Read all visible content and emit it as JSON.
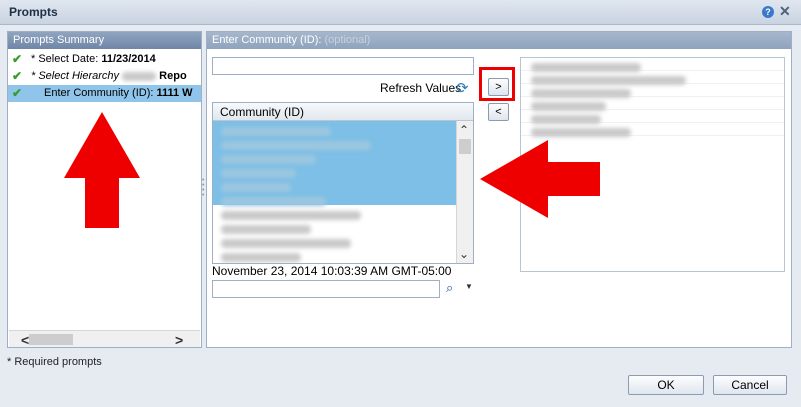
{
  "dialog": {
    "title": "Prompts",
    "help_icon": "help-icon",
    "close_icon": "close-icon"
  },
  "summary": {
    "header": "Prompts Summary",
    "items": [
      {
        "icon": "check-icon",
        "label": "* Select Date: ",
        "value": "11/23/2014"
      },
      {
        "icon": "check-icon",
        "label": "* Select Hierarchy",
        "value": "Repo"
      },
      {
        "icon": "check-icon",
        "label": "Enter Community (ID): ",
        "value": "1111 W"
      }
    ]
  },
  "prompt": {
    "header": "Enter Community (ID):",
    "optional_hint": "(optional)",
    "search_value": "",
    "refresh_label": "Refresh Values",
    "add_button": ">",
    "remove_button": "<",
    "list_header": "Community (ID)",
    "timestamp": "November 23, 2014 10:03:39 AM GMT-05:00",
    "search_field_value": ""
  },
  "footer": {
    "required_note": "* Required prompts",
    "ok_label": "OK",
    "cancel_label": "Cancel"
  },
  "colors": {
    "selection": "#7dbfe6",
    "annotation_red": "#ee0000",
    "check_green": "#3c9a2d"
  }
}
